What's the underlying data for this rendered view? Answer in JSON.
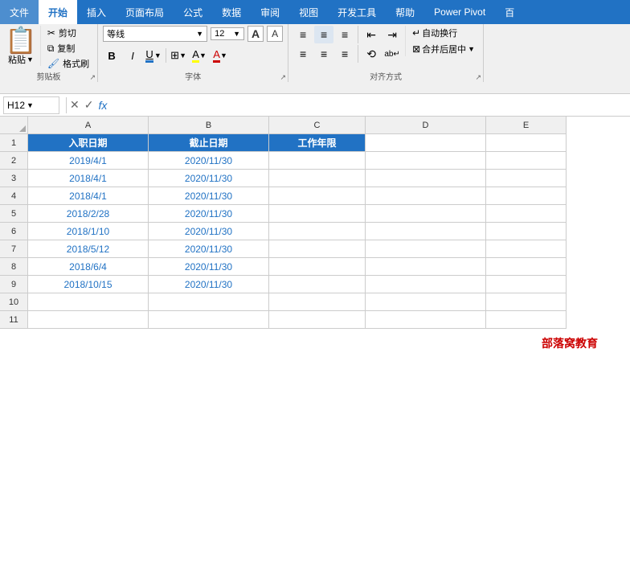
{
  "menuBar": {
    "items": [
      "文件",
      "开始",
      "插入",
      "页面布局",
      "公式",
      "数据",
      "审阅",
      "视图",
      "开发工具",
      "帮助",
      "Power Pivot",
      "百"
    ]
  },
  "ribbon": {
    "clipboard": {
      "label": "剪贴板",
      "paste": "粘贴",
      "cut": "剪切",
      "copy": "复制",
      "formatPainter": "格式刷"
    },
    "font": {
      "label": "字体",
      "fontName": "等线",
      "fontSize": "12",
      "bold": "B",
      "italic": "I",
      "underline": "U",
      "border": "⊞",
      "fillColor": "A",
      "fontColor": "A"
    },
    "alignment": {
      "label": "对齐方式",
      "autoWrap": "自动换行",
      "merge": "合并后居中"
    }
  },
  "formulaBar": {
    "cellRef": "H12",
    "cancelSymbol": "✕",
    "confirmSymbol": "✓",
    "fxSymbol": "fx",
    "formula": ""
  },
  "columns": {
    "headers": [
      "A",
      "B",
      "C",
      "D",
      "E"
    ],
    "widths": [
      150,
      150,
      120,
      150,
      100
    ]
  },
  "rows": [
    {
      "num": 1,
      "cells": [
        "入职日期",
        "截止日期",
        "工作年限",
        "",
        ""
      ]
    },
    {
      "num": 2,
      "cells": [
        "2019/4/1",
        "2020/11/30",
        "",
        "",
        ""
      ]
    },
    {
      "num": 3,
      "cells": [
        "2018/4/1",
        "2020/11/30",
        "",
        "",
        ""
      ]
    },
    {
      "num": 4,
      "cells": [
        "2018/4/1",
        "2020/11/30",
        "",
        "",
        ""
      ]
    },
    {
      "num": 5,
      "cells": [
        "2018/2/28",
        "2020/11/30",
        "",
        "",
        ""
      ]
    },
    {
      "num": 6,
      "cells": [
        "2018/1/10",
        "2020/11/30",
        "",
        "",
        ""
      ]
    },
    {
      "num": 7,
      "cells": [
        "2018/5/12",
        "2020/11/30",
        "",
        "",
        ""
      ]
    },
    {
      "num": 8,
      "cells": [
        "2018/6/4",
        "2020/11/30",
        "",
        "",
        ""
      ]
    },
    {
      "num": 9,
      "cells": [
        "2018/10/15",
        "2020/11/30",
        "",
        "",
        ""
      ]
    },
    {
      "num": 10,
      "cells": [
        "",
        "",
        "",
        "",
        ""
      ]
    },
    {
      "num": 11,
      "cells": [
        "",
        "",
        "",
        "",
        ""
      ]
    }
  ],
  "watermark": "部落窝教育",
  "selectedCell": "H12",
  "activeTab": "开始"
}
